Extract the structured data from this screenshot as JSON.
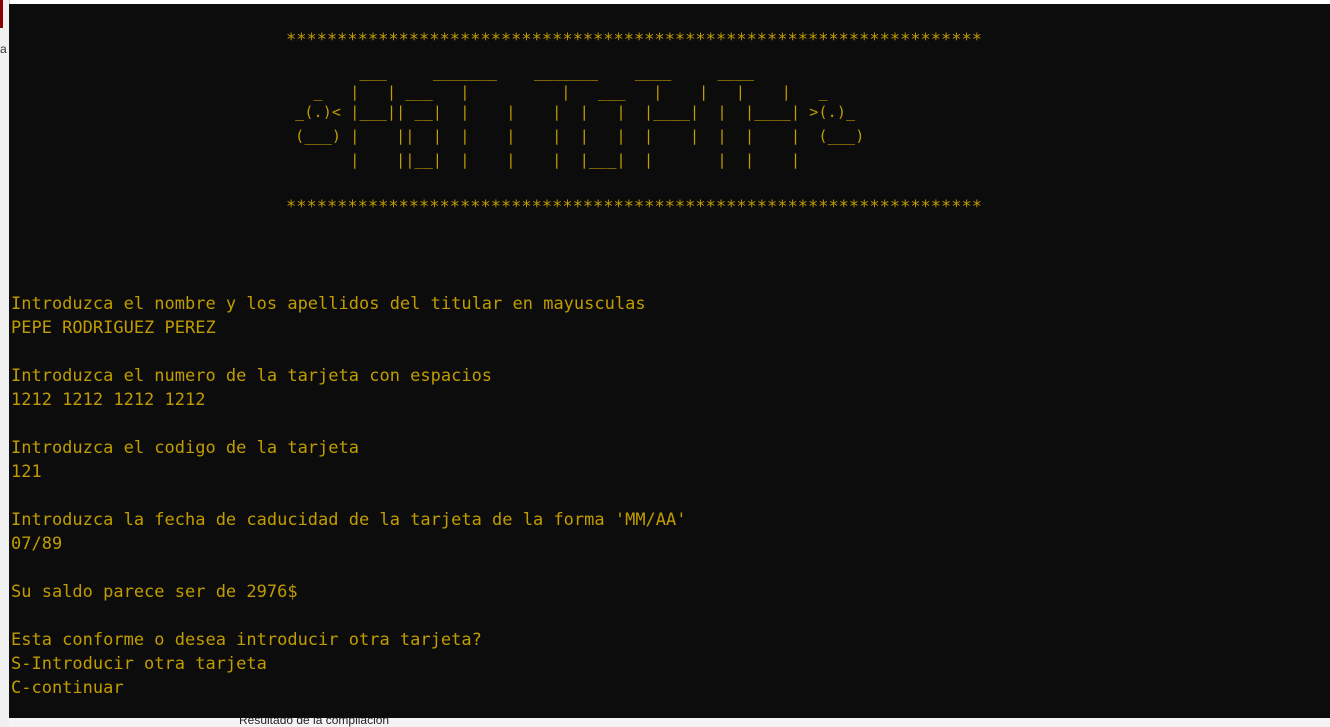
{
  "window": {
    "left_edge_letter": "a"
  },
  "banner": {
    "stars_top": "********************************************************************",
    "art": [
      "        ___     _______    _______    ____     ____",
      "   _   |   | ___   |          |   ___   |    |   |    |   _",
      " _(.)< |___|| __|  |    |    |  |   |  |____|  |  |____| >(.)_",
      " (___) |    ||  |  |    |    |  |   |  |    |  |  |    |  (___)",
      "       |    ||__|  |    |    |  |___|  |       |  |    |"
    ],
    "stars_bottom": "********************************************************************"
  },
  "console": {
    "lines": [
      "Introduzca el nombre y los apellidos del titular en mayusculas",
      "PEPE RODRIGUEZ PEREZ",
      "",
      "Introduzca el numero de la tarjeta con espacios",
      "1212 1212 1212 1212",
      "",
      "Introduzca el codigo de la tarjeta",
      "121",
      "",
      "Introduzca la fecha de caducidad de la tarjeta de la forma 'MM/AA'",
      "07/89",
      "",
      "Su saldo parece ser de 2976$",
      "",
      "Esta conforme o desea introducir otra tarjeta?",
      "S-Introducir otra tarjeta",
      "C-continuar"
    ]
  },
  "taskbar": {
    "items": [
      "Resultado de la compilacion"
    ]
  }
}
